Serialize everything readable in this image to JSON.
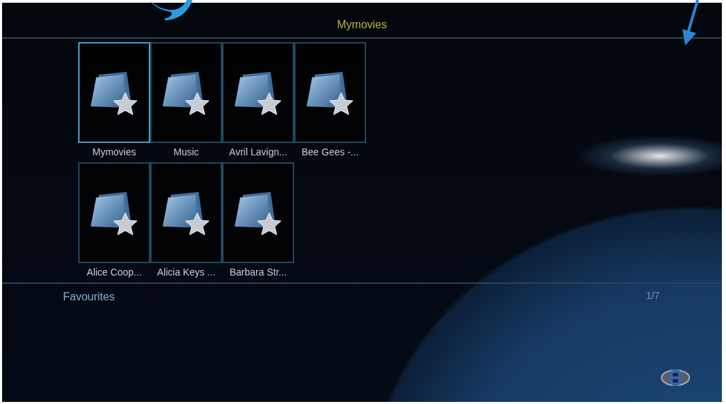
{
  "header": {
    "title": "Mymovies"
  },
  "items": [
    {
      "label": "Mymovies",
      "selected": true
    },
    {
      "label": "Music",
      "selected": false
    },
    {
      "label": "Avril Lavign...",
      "selected": false
    },
    {
      "label": "Bee Gees -...",
      "selected": false
    },
    {
      "label": "Alice Coop...",
      "selected": false
    },
    {
      "label": "Alicia Keys ...",
      "selected": false
    },
    {
      "label": "Barbara Str...",
      "selected": false
    }
  ],
  "footer": {
    "section": "Favourites",
    "page": "1/7"
  }
}
